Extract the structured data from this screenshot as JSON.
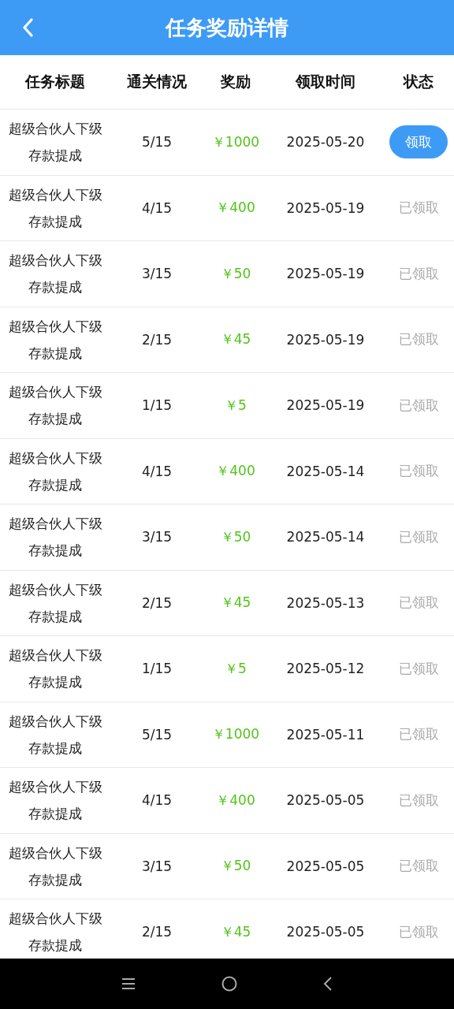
{
  "header": {
    "title": "任务奖励详情"
  },
  "table": {
    "columns": [
      "任务标题",
      "通关情况",
      "奖励",
      "领取时间",
      "状态"
    ],
    "rows": [
      {
        "title": "超级合伙人下级存款提成",
        "progress": "5/15",
        "reward": "￥1000",
        "time": "2025-05-20",
        "status": "领取",
        "claimed": false
      },
      {
        "title": "超级合伙人下级存款提成",
        "progress": "4/15",
        "reward": "￥400",
        "time": "2025-05-19",
        "status": "已领取",
        "claimed": true
      },
      {
        "title": "超级合伙人下级存款提成",
        "progress": "3/15",
        "reward": "￥50",
        "time": "2025-05-19",
        "status": "已领取",
        "claimed": true
      },
      {
        "title": "超级合伙人下级存款提成",
        "progress": "2/15",
        "reward": "￥45",
        "time": "2025-05-19",
        "status": "已领取",
        "claimed": true
      },
      {
        "title": "超级合伙人下级存款提成",
        "progress": "1/15",
        "reward": "￥5",
        "time": "2025-05-19",
        "status": "已领取",
        "claimed": true
      },
      {
        "title": "超级合伙人下级存款提成",
        "progress": "4/15",
        "reward": "￥400",
        "time": "2025-05-14",
        "status": "已领取",
        "claimed": true
      },
      {
        "title": "超级合伙人下级存款提成",
        "progress": "3/15",
        "reward": "￥50",
        "time": "2025-05-14",
        "status": "已领取",
        "claimed": true
      },
      {
        "title": "超级合伙人下级存款提成",
        "progress": "2/15",
        "reward": "￥45",
        "time": "2025-05-13",
        "status": "已领取",
        "claimed": true
      },
      {
        "title": "超级合伙人下级存款提成",
        "progress": "1/15",
        "reward": "￥5",
        "time": "2025-05-12",
        "status": "已领取",
        "claimed": true
      },
      {
        "title": "超级合伙人下级存款提成",
        "progress": "5/15",
        "reward": "￥1000",
        "time": "2025-05-11",
        "status": "已领取",
        "claimed": true
      },
      {
        "title": "超级合伙人下级存款提成",
        "progress": "4/15",
        "reward": "￥400",
        "time": "2025-05-05",
        "status": "已领取",
        "claimed": true
      },
      {
        "title": "超级合伙人下级存款提成",
        "progress": "3/15",
        "reward": "￥50",
        "time": "2025-05-05",
        "status": "已领取",
        "claimed": true
      },
      {
        "title": "超级合伙人下级存款提成",
        "progress": "2/15",
        "reward": "￥45",
        "time": "2025-05-05",
        "status": "已领取",
        "claimed": true
      }
    ]
  }
}
